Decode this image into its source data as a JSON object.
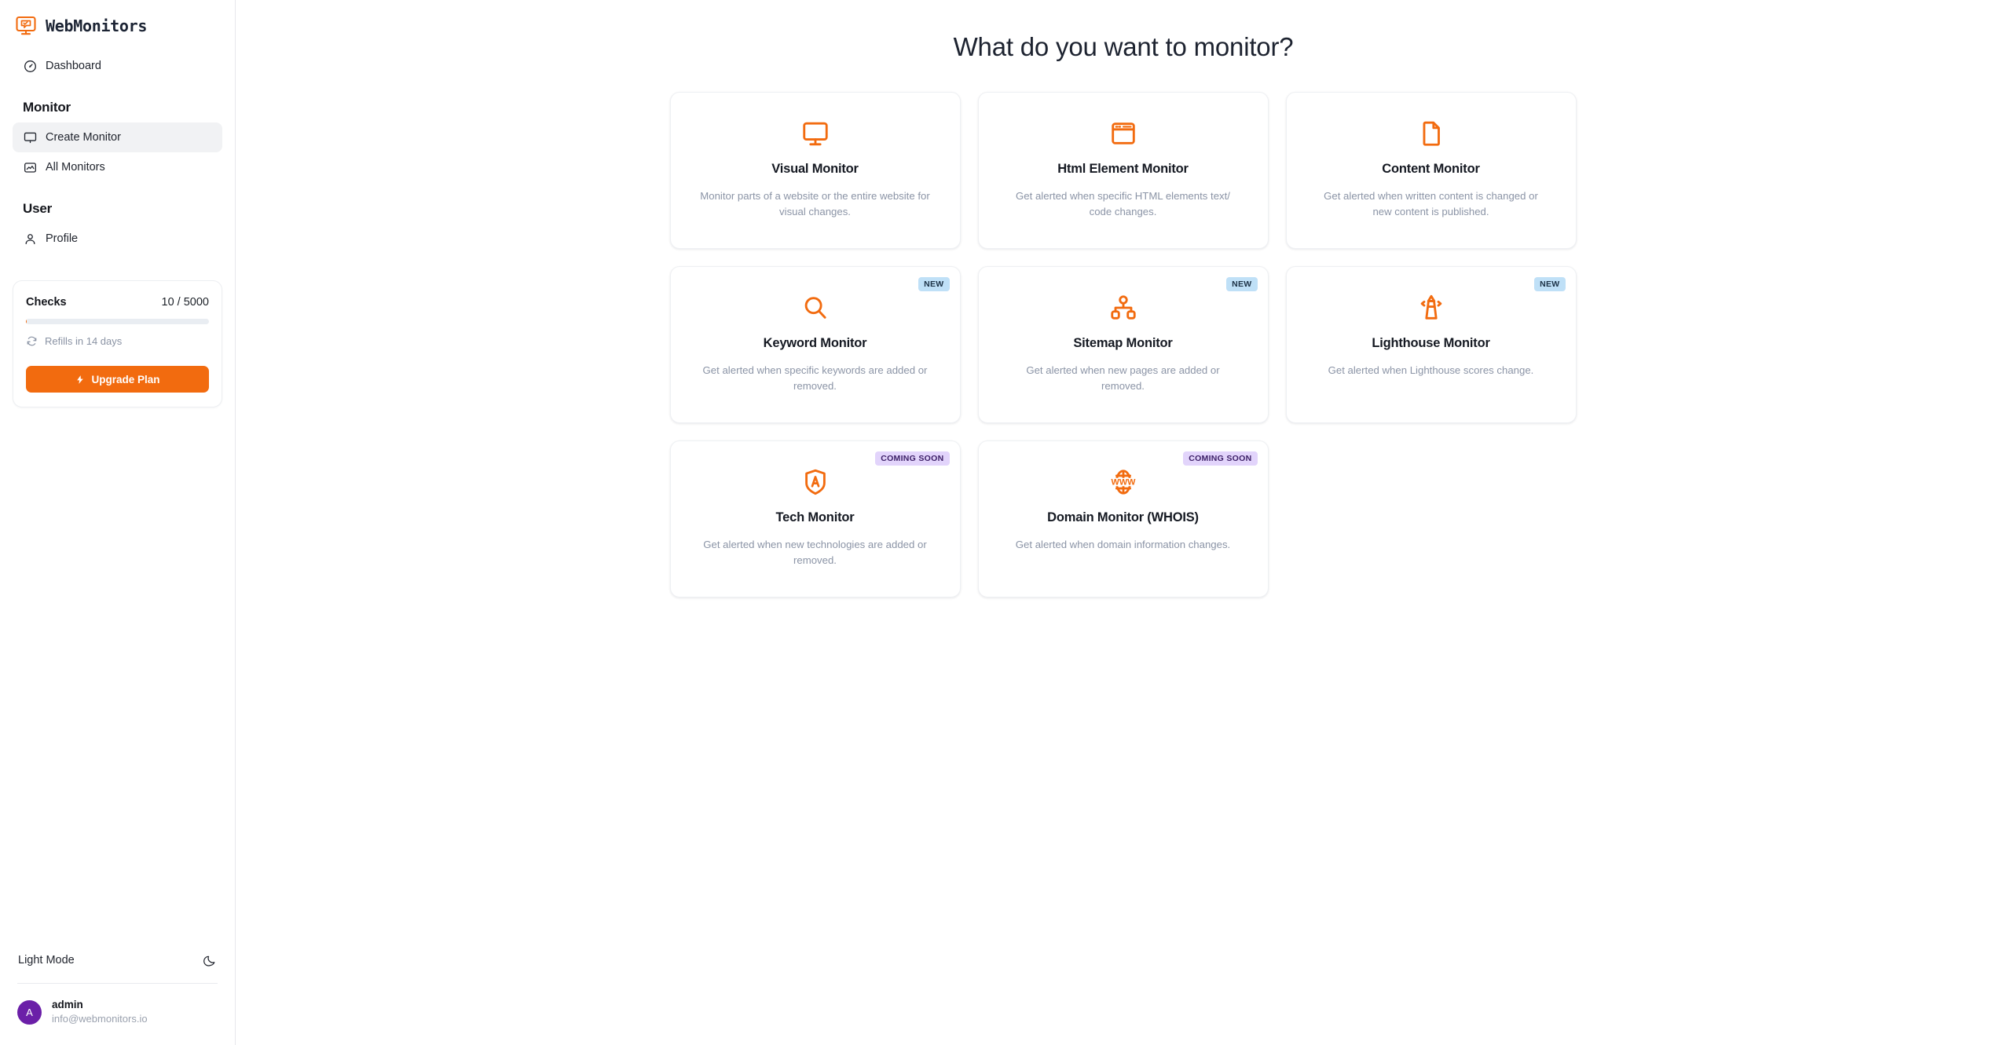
{
  "brand": {
    "name": "WebMonitors",
    "logo_icon": "monitor-chat-check-icon"
  },
  "sidebar": {
    "top_items": [
      {
        "label": "Dashboard",
        "icon": "gauge-icon",
        "active": false
      }
    ],
    "groups": [
      {
        "title": "Monitor",
        "items": [
          {
            "label": "Create Monitor",
            "icon": "monitor-icon",
            "active": true
          },
          {
            "label": "All Monitors",
            "icon": "image-chart-icon",
            "active": false
          }
        ]
      },
      {
        "title": "User",
        "items": [
          {
            "label": "Profile",
            "icon": "user-icon",
            "active": false
          }
        ]
      }
    ],
    "checks": {
      "label": "Checks",
      "value": "10 / 5000",
      "used": 10,
      "total": 5000,
      "refill_text": "Refills in 14 days",
      "refill_icon": "refresh-icon",
      "upgrade_label": "Upgrade Plan",
      "upgrade_icon": "bolt-icon",
      "accent_color": "#f26b0f"
    },
    "theme_toggle": {
      "label": "Light Mode",
      "icon": "moon-icon"
    },
    "user": {
      "initial": "A",
      "name": "admin",
      "email": "info@webmonitors.io",
      "avatar_color": "#6b1fa8"
    }
  },
  "main": {
    "title": "What do you want to monitor?",
    "cards": [
      {
        "id": "visual-monitor",
        "icon": "monitor-icon",
        "title": "Visual Monitor",
        "description": "Monitor parts of a website or the entire website for visual changes.",
        "badge": null
      },
      {
        "id": "html-element-monitor",
        "icon": "browser-window-icon",
        "title": "Html Element Monitor",
        "description": "Get alerted when specific HTML elements text/ code changes.",
        "badge": null
      },
      {
        "id": "content-monitor",
        "icon": "document-icon",
        "title": "Content Monitor",
        "description": "Get alerted when written content is changed or new content is published.",
        "badge": null
      },
      {
        "id": "keyword-monitor",
        "icon": "search-icon",
        "title": "Keyword Monitor",
        "description": "Get alerted when specific keywords are added or removed.",
        "badge": "NEW"
      },
      {
        "id": "sitemap-monitor",
        "icon": "sitemap-icon",
        "title": "Sitemap Monitor",
        "description": "Get alerted when new pages are added or removed.",
        "badge": "NEW"
      },
      {
        "id": "lighthouse-monitor",
        "icon": "lighthouse-icon",
        "title": "Lighthouse Monitor",
        "description": "Get alerted when Lighthouse scores change.",
        "badge": "NEW"
      },
      {
        "id": "tech-monitor",
        "icon": "shield-a-icon",
        "title": "Tech Monitor",
        "description": "Get alerted when new technologies are added or removed.",
        "badge": "COMING SOON"
      },
      {
        "id": "domain-monitor-whois",
        "icon": "globe-www-icon",
        "title": "Domain Monitor (WHOIS)",
        "description": "Get alerted when domain information changes.",
        "badge": "COMING SOON"
      }
    ],
    "badge_colors": {
      "new_bg": "#bfe0f7",
      "new_text": "#1d3246",
      "soon_bg": "#e2d4fb",
      "soon_text": "#3d2068"
    },
    "icon_color": "#f26b0f"
  }
}
